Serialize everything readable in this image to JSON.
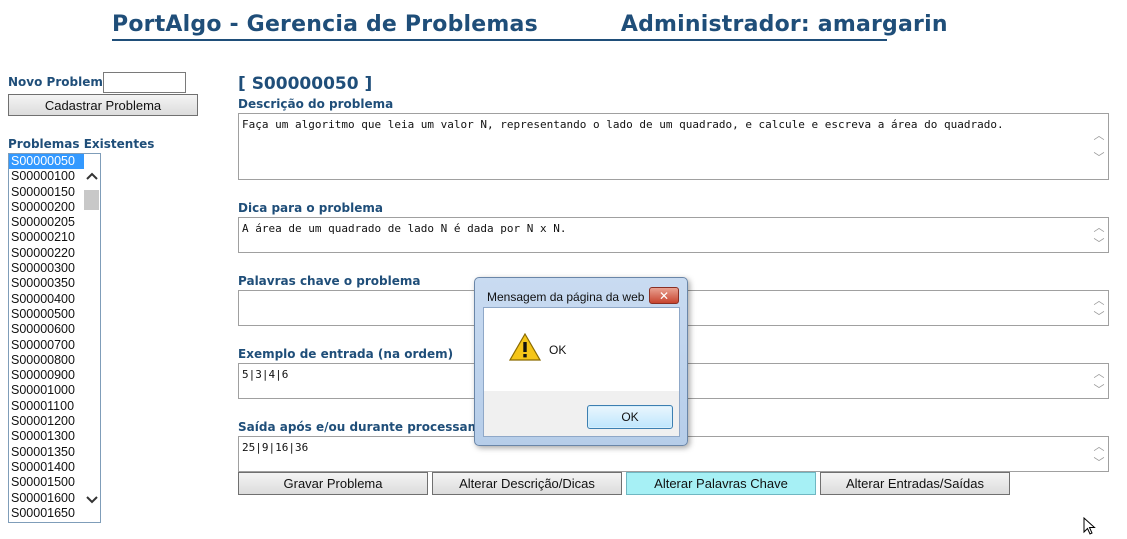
{
  "header": {
    "title": "PortAlgo - Gerencia de Problemas",
    "admin": "Administrador: amargarin"
  },
  "sidebar": {
    "new_problem_label": "Novo Problema",
    "new_problem_value": "",
    "register_button": "Cadastrar Problema",
    "existing_label": "Problemas Existentes",
    "problems": [
      "S00000050",
      "S00000100",
      "S00000150",
      "S00000200",
      "S00000205",
      "S00000210",
      "S00000220",
      "S00000300",
      "S00000350",
      "S00000400",
      "S00000500",
      "S00000600",
      "S00000700",
      "S00000800",
      "S00000900",
      "S00001000",
      "S00001100",
      "S00001200",
      "S00001300",
      "S00001350",
      "S00001400",
      "S00001500",
      "S00001600",
      "S00001650"
    ],
    "selected": "S00000050"
  },
  "main": {
    "problem_id": "[ S00000050 ]",
    "description_label": "Descrição do problema",
    "description_value": "Faça um algoritmo que leia um valor N, representando o lado de um quadrado, e calcule e escreva a área do quadrado.",
    "hint_label": "Dica para o problema",
    "hint_value": "A área de um quadrado de lado N é dada por N x N.",
    "keywords_label": "Palavras chave o problema",
    "keywords_value": "",
    "input_label": "Exemplo de entrada (na ordem)",
    "input_value": "5|3|4|6",
    "output_label": "Saída após e/ou durante processamento",
    "output_value": "25|9|16|36"
  },
  "actions": {
    "save": "Gravar Problema",
    "edit_desc": "Alterar Descrição/Dicas",
    "edit_keywords": "Alterar Palavras Chave",
    "edit_io": "Alterar Entradas/Saídas"
  },
  "dialog": {
    "title": "Mensagem da página da web",
    "message": "OK",
    "ok_button": "OK",
    "close_glyph": "✕",
    "icon": "warning-icon"
  },
  "colors": {
    "heading": "#1f4e79",
    "selection": "#3399ff",
    "active_button": "#a6f0f5"
  }
}
